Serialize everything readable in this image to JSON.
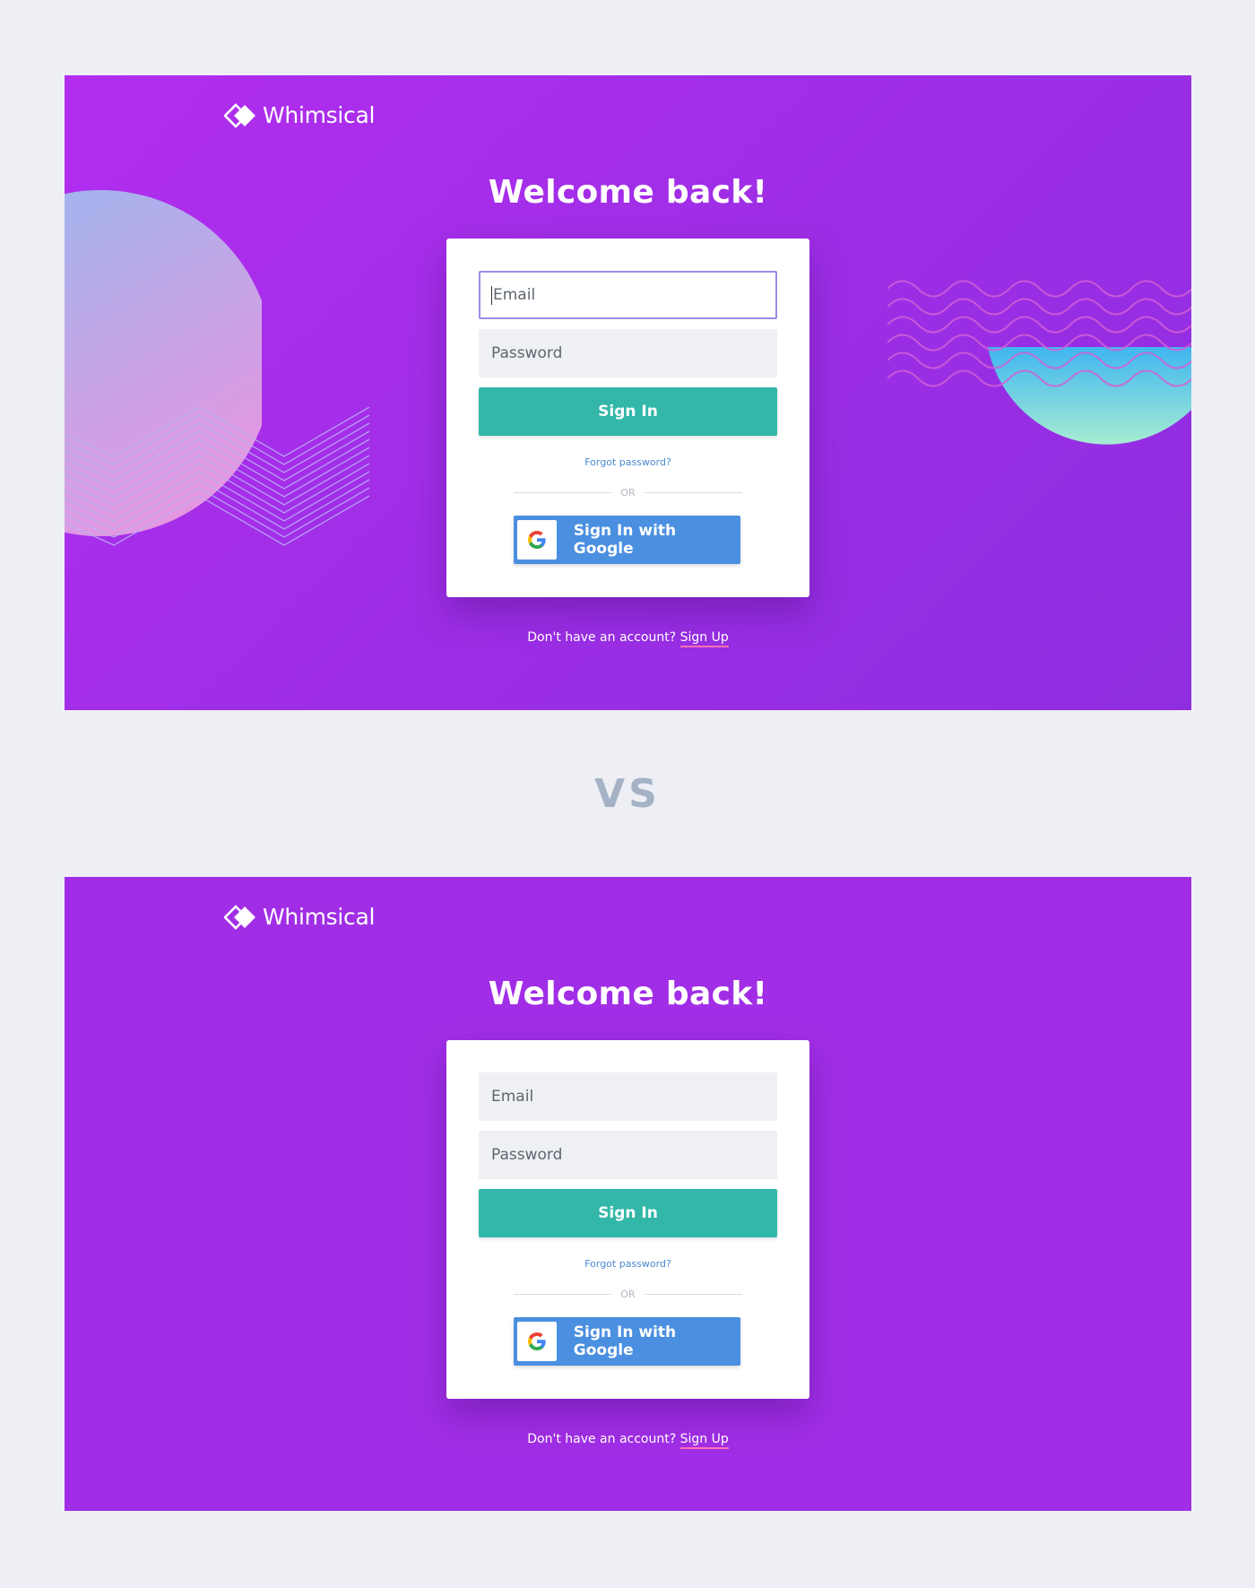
{
  "comparison_label": "VS",
  "variants": [
    {
      "logo_text": "Whimsical",
      "heading": "Welcome back!",
      "email_placeholder": "Email",
      "password_placeholder": "Password",
      "signin_label": "Sign In",
      "forgot_label": "Forgot password?",
      "or_label": "OR",
      "google_label": "Sign In with Google",
      "no_account_text": "Don't have an account?",
      "signup_label": "Sign Up"
    },
    {
      "logo_text": "Whimsical",
      "heading": "Welcome back!",
      "email_placeholder": "Email",
      "password_placeholder": "Password",
      "signin_label": "Sign In",
      "forgot_label": "Forgot password?",
      "or_label": "OR",
      "google_label": "Sign In with Google",
      "no_account_text": "Don't have an account?",
      "signup_label": "Sign Up"
    }
  ],
  "colors": {
    "brand_purple": "#a12ee6",
    "signin_teal": "#33b7a9",
    "google_blue": "#4a8fe0",
    "link_blue": "#4a8ad0",
    "signup_underline": "#ff6fb1",
    "vs_gray": "#a5b2c6"
  },
  "icons": {
    "logo": "whimsical-diamond-logo-icon",
    "google": "google-g-icon"
  }
}
